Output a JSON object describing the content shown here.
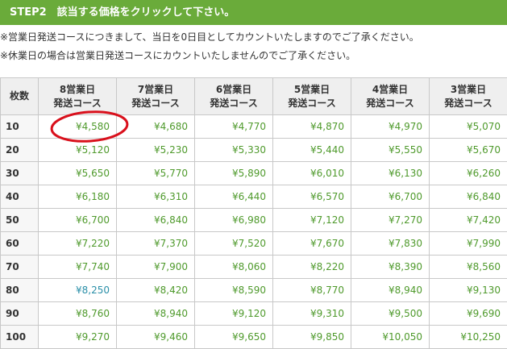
{
  "header": {
    "title": "STEP2　該当する価格をクリックして下さい。"
  },
  "notes": [
    "※営業日発送コースにつきまして、当日を0日目としてカウントいたしますのでご了承ください。",
    "※休業日の場合は営業日発送コースにカウントいたしませんのでご了承ください。"
  ],
  "table": {
    "qty_header": "枚数",
    "columns": [
      {
        "line1": "8営業日",
        "line2": "発送コース"
      },
      {
        "line1": "7営業日",
        "line2": "発送コース"
      },
      {
        "line1": "6営業日",
        "line2": "発送コース"
      },
      {
        "line1": "5営業日",
        "line2": "発送コース"
      },
      {
        "line1": "4営業日",
        "line2": "発送コース"
      },
      {
        "line1": "3営業日",
        "line2": "発送コース"
      }
    ],
    "rows": [
      {
        "qty": "10",
        "prices": [
          "¥4,580",
          "¥4,680",
          "¥4,770",
          "¥4,870",
          "¥4,970",
          "¥5,070"
        ]
      },
      {
        "qty": "20",
        "prices": [
          "¥5,120",
          "¥5,230",
          "¥5,330",
          "¥5,440",
          "¥5,550",
          "¥5,670"
        ]
      },
      {
        "qty": "30",
        "prices": [
          "¥5,650",
          "¥5,770",
          "¥5,890",
          "¥6,010",
          "¥6,130",
          "¥6,260"
        ]
      },
      {
        "qty": "40",
        "prices": [
          "¥6,180",
          "¥6,310",
          "¥6,440",
          "¥6,570",
          "¥6,700",
          "¥6,840"
        ]
      },
      {
        "qty": "50",
        "prices": [
          "¥6,700",
          "¥6,840",
          "¥6,980",
          "¥7,120",
          "¥7,270",
          "¥7,420"
        ]
      },
      {
        "qty": "60",
        "prices": [
          "¥7,220",
          "¥7,370",
          "¥7,520",
          "¥7,670",
          "¥7,830",
          "¥7,990"
        ]
      },
      {
        "qty": "70",
        "prices": [
          "¥7,740",
          "¥7,900",
          "¥8,060",
          "¥8,220",
          "¥8,390",
          "¥8,560"
        ]
      },
      {
        "qty": "80",
        "prices": [
          "¥8,250",
          "¥8,420",
          "¥8,590",
          "¥8,770",
          "¥8,940",
          "¥9,130"
        ]
      },
      {
        "qty": "90",
        "prices": [
          "¥8,760",
          "¥8,940",
          "¥9,120",
          "¥9,310",
          "¥9,500",
          "¥9,690"
        ]
      },
      {
        "qty": "100",
        "prices": [
          "¥9,270",
          "¥9,460",
          "¥9,650",
          "¥9,850",
          "¥10,050",
          "¥10,250"
        ]
      }
    ],
    "hover_cell": {
      "row": 7,
      "col": 0
    }
  },
  "colors": {
    "header_bg": "#6aab3a",
    "price_text": "#4f9a2c",
    "hover_price_text": "#2a8fa8",
    "circle_mark": "#d9101c"
  }
}
